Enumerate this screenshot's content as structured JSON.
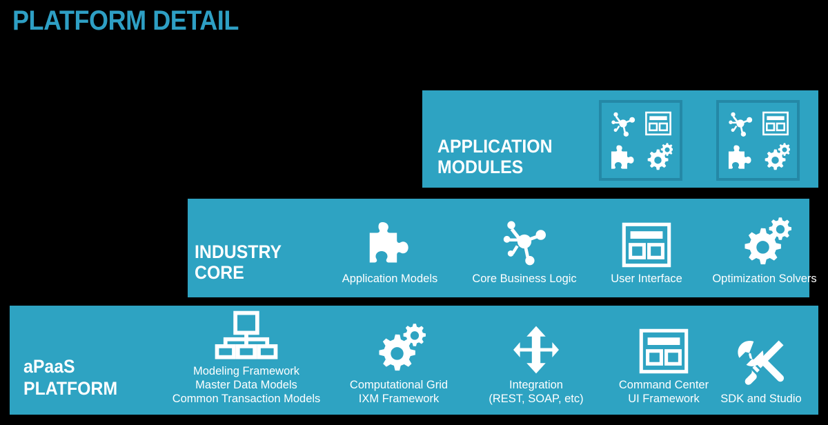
{
  "page": {
    "title": "PLATFORM DETAIL",
    "background_color": "#000000",
    "accent_color": "#2EA3C2",
    "title_color": "#2E9FC4",
    "box_border_color": "#2488A6",
    "text_color": "#FFFFFF"
  },
  "bands": [
    {
      "id": "application-modules",
      "label": "APPLICATION\nMODULES",
      "modules": [
        {
          "id": "module-1",
          "icons": [
            "network-node-icon",
            "window-layout-icon",
            "puzzle-piece-icon",
            "gears-icon"
          ]
        },
        {
          "id": "module-2",
          "icons": [
            "network-node-icon",
            "window-layout-icon",
            "puzzle-piece-icon",
            "gears-icon"
          ]
        }
      ]
    },
    {
      "id": "industry-core",
      "label": "INDUSTRY\nCORE",
      "items": [
        {
          "icon": "puzzle-piece-icon",
          "caption": "Application Models"
        },
        {
          "icon": "network-node-icon",
          "caption": "Core Business Logic"
        },
        {
          "icon": "window-layout-icon",
          "caption": "User Interface"
        },
        {
          "icon": "gears-icon",
          "caption": "Optimization Solvers"
        }
      ]
    },
    {
      "id": "apaas-platform",
      "label": "aPaaS\nPLATFORM",
      "items": [
        {
          "icon": "hierarchy-icon",
          "caption": "Modeling Framework\nMaster Data Models\nCommon Transaction Models"
        },
        {
          "icon": "gears-icon",
          "caption": "Computational Grid\nIXM Framework"
        },
        {
          "icon": "four-way-arrow-icon",
          "caption": "Integration\n(REST, SOAP, etc)"
        },
        {
          "icon": "window-layout-icon",
          "caption": "Command Center\nUI Framework"
        },
        {
          "icon": "tools-icon",
          "caption": "SDK and Studio"
        }
      ]
    }
  ]
}
